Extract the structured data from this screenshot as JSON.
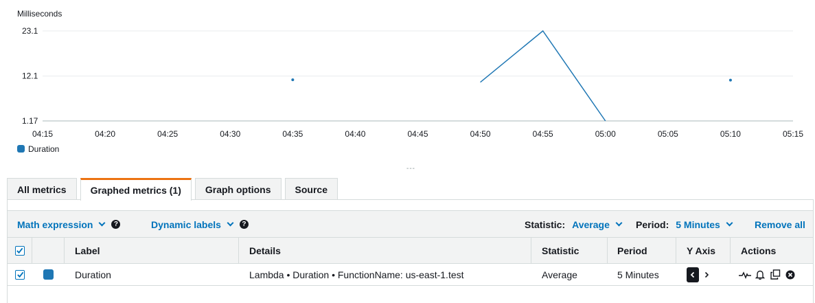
{
  "chart_data": {
    "type": "line",
    "ylabel": "Milliseconds",
    "y_ticks": [
      "23.1",
      "12.1",
      "1.17"
    ],
    "ylim": [
      1.17,
      23.1
    ],
    "x_ticks": [
      "04:15",
      "04:20",
      "04:25",
      "04:30",
      "04:35",
      "04:40",
      "04:45",
      "04:50",
      "04:55",
      "05:00",
      "05:05",
      "05:10",
      "05:15"
    ],
    "series": [
      {
        "name": "Duration",
        "color": "#1f77b4",
        "points": [
          {
            "x": "04:35",
            "y": 11.2
          },
          {
            "x": "04:50",
            "y": 10.6
          },
          {
            "x": "04:55",
            "y": 23.1
          },
          {
            "x": "05:00",
            "y": 1.17
          },
          {
            "x": "05:10",
            "y": 11.1
          }
        ],
        "segments": [
          [
            1,
            2,
            3
          ]
        ]
      }
    ],
    "grid": true,
    "legend_position": "bottom-left"
  },
  "resize_handle": "---",
  "tabs": [
    {
      "label": "All metrics",
      "active": false
    },
    {
      "label": "Graphed metrics (1)",
      "active": true
    },
    {
      "label": "Graph options",
      "active": false
    },
    {
      "label": "Source",
      "active": false
    }
  ],
  "toolbar": {
    "math_expression": "Math expression",
    "dynamic_labels": "Dynamic labels",
    "help_glyph": "?",
    "statistic_label": "Statistic:",
    "statistic_value": "Average",
    "period_label": "Period:",
    "period_value": "5 Minutes",
    "remove_all": "Remove all"
  },
  "table": {
    "columns": {
      "label": "Label",
      "details": "Details",
      "statistic": "Statistic",
      "period": "Period",
      "y_axis": "Y Axis",
      "actions": "Actions"
    },
    "rows": [
      {
        "checked": true,
        "color": "#1f77b4",
        "label": "Duration",
        "details": "Lambda • Duration • FunctionName: us-east-1.test",
        "statistic": "Average",
        "period": "5 Minutes",
        "y_axis_selected": "left"
      }
    ],
    "actions_icons": [
      "math-graph-icon",
      "bell-alarm-icon",
      "copy-icon",
      "remove-circle-icon"
    ]
  }
}
